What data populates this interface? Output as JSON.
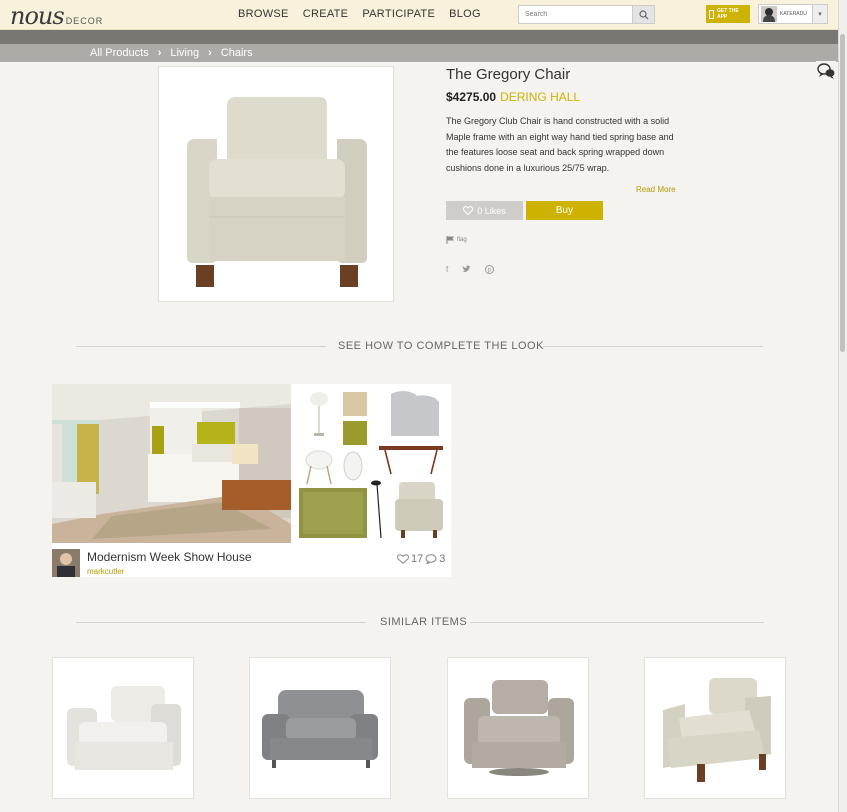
{
  "header": {
    "logo_script": "nous",
    "logo_word": "DECOR",
    "nav": [
      "BROWSE",
      "CREATE",
      "PARTICIPATE",
      "BLOG"
    ],
    "search_placeholder": "Search",
    "get_app": "GET THE APP",
    "username": "KATERADU"
  },
  "breadcrumb": [
    "All Products",
    "Living",
    "Chairs"
  ],
  "product": {
    "title": "The Gregory Chair",
    "price": "$4275.00",
    "brand": "DERING HALL",
    "description": "The Gregory Club Chair is hand constructed with a solid Maple frame with an eight way hand tied spring base and the features loose seat and back spring wrapped down cushions done in a luxurious 25/75 wrap.",
    "read_more": "Read More",
    "likes": "0 Likes",
    "buy": "Buy",
    "flag": "flag"
  },
  "look_section": {
    "heading": "SEE HOW TO COMPLETE THE LOOK",
    "card": {
      "title": "Modernism Week Show House",
      "user": "markcutler",
      "likes": "17",
      "comments": "3"
    }
  },
  "similar_section": {
    "heading": "SIMILAR ITEMS"
  },
  "colors": {
    "accent": "#cdb200",
    "background": "#f4f3ef",
    "header": "#f8f2dc",
    "breadcrumb_bar": "#aeaaa6"
  }
}
